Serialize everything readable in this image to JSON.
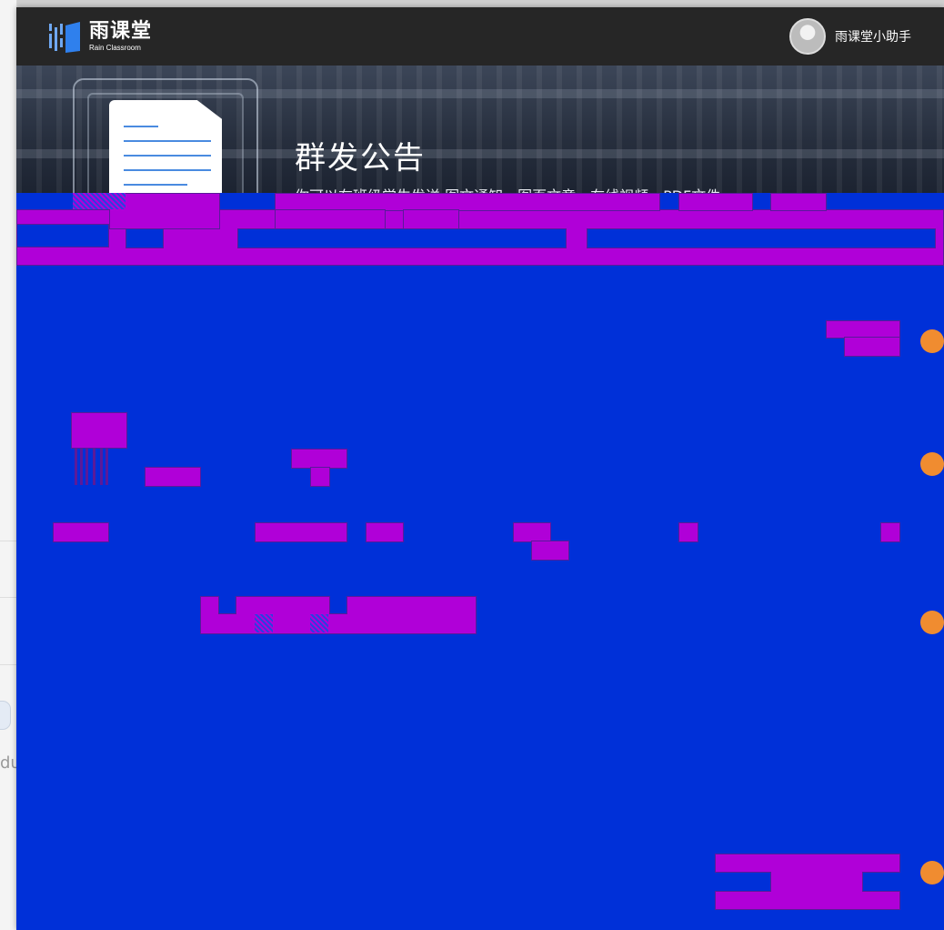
{
  "app": {
    "logo_cn": "雨课堂",
    "logo_en": "Rain Classroom",
    "brand_color": "#2f80ed"
  },
  "user": {
    "name": "雨课堂小助手",
    "avatar_icon": "user-avatar-icon"
  },
  "banner": {
    "title": "群发公告",
    "description": "你可以在班级学生发送 图文通知、图页文章、在线视频、PDF文件"
  },
  "colors": {
    "topbar": "#262626",
    "content_placeholder": "#0030d8",
    "corrupted_blocks": "#b000d8",
    "step_indicator": "#f08c30"
  },
  "background_page": {
    "partial_text": "du"
  }
}
